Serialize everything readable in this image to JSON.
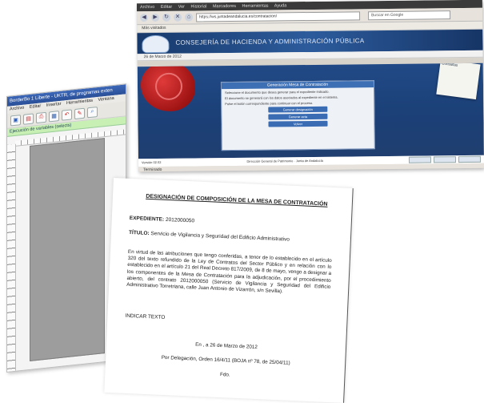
{
  "openoffice": {
    "title": "BorderBo 1 Liberte - UKTR, de programas exten",
    "menu": [
      "Archivo",
      "Editar",
      "Insertar",
      "Herramientas",
      "Ventana"
    ],
    "green_bar": "Ejecución de variables (selects)"
  },
  "browser": {
    "menubar": [
      "Archivo",
      "Editar",
      "Ver",
      "Historial",
      "Marcadores",
      "Herramientas",
      "Ayuda"
    ],
    "url": "https://ws.juntadeandalucia.es/contratacion/",
    "search": "Buscar en Google",
    "bookmarks": "Más visitados",
    "brand": "CONSEJERÍA DE HACIENDA Y ADMINISTRACIÓN PÚBLICA",
    "date": "26 de Marzo de 2012",
    "notepad_label": "Consultas",
    "dialog": {
      "header": "Generación Mesa de Contratación",
      "paragraphs": [
        "Seleccione el documento que desea generar para el expediente indicado.",
        "El documento se generará con los datos asociados al expediente en el sistema.",
        "Pulse el botón correspondiente para continuar con el proceso."
      ],
      "buttons": [
        "Generar designación",
        "Generar acta",
        "Volver"
      ]
    },
    "footer_left": "Versión 02.02",
    "footer_center": "Dirección General de Patrimonio · Junta de Andalucía",
    "status": "Terminado"
  },
  "document": {
    "title": "DESIGNACIÓN DE COMPOSICIÓN DE LA MESA DE CONTRATACIÓN",
    "expediente_label": "EXPEDIENTE:",
    "expediente_value": "2012000050",
    "titulo_label": "TÍTULO:",
    "titulo_value": "Servicio de Vigilancia y Seguridad del Edificio Administrativo",
    "body": "En virtud de las atribuciones que tengo conferidas, a tenor de lo establecido en el artículo 320 del texto refundido de la Ley de Contratos del Sector Público y en relación con lo establecido en el artículo 21 del Real Decreto 817/2009, de 8 de mayo, vengo a designar a los componentes de la Mesa de Contratación para la adjudicación, por el procedimiento abierto, del contrato 2012000050 (Servicio de Vigilancia y Seguridad del Edificio Administrativo Torretriana, calle Juan Antonio de Vizarrón, s/n Sevilla).",
    "placeholder": "INDICAR TEXTO",
    "date_line": "En , a 26 de Marzo de 2012",
    "delegation": "Por Delegación, Orden 16/4/11 (BOJA nº 78, de 25/04/11)",
    "signed": "Fdo."
  }
}
